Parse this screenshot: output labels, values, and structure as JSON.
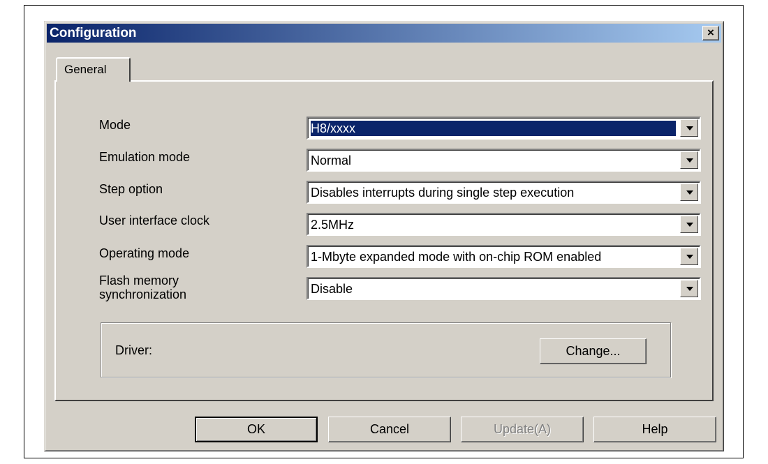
{
  "window": {
    "title": "Configuration",
    "close_glyph": "×"
  },
  "tabs": [
    {
      "label": "General",
      "active": true
    }
  ],
  "fields": [
    {
      "label": "Mode",
      "value": "H8/xxxx",
      "selected": true
    },
    {
      "label": "Emulation mode",
      "value": "Normal"
    },
    {
      "label": "Step option",
      "value": "Disables interrupts during single step execution"
    },
    {
      "label": "User interface clock",
      "value": "2.5MHz"
    },
    {
      "label": "Operating mode",
      "value": "1-Mbyte expanded mode with on-chip ROM enabled"
    },
    {
      "label": "Flash memory synchronization",
      "value": "Disable"
    }
  ],
  "driver": {
    "label": "Driver:",
    "change_button": "Change..."
  },
  "buttons": {
    "ok": "OK",
    "cancel": "Cancel",
    "update": "Update(A)",
    "help": "Help"
  },
  "colors": {
    "titlebar_start": "#0a246a",
    "titlebar_end": "#a6caf0",
    "face": "#d4d0c8",
    "selection": "#0a246a"
  }
}
